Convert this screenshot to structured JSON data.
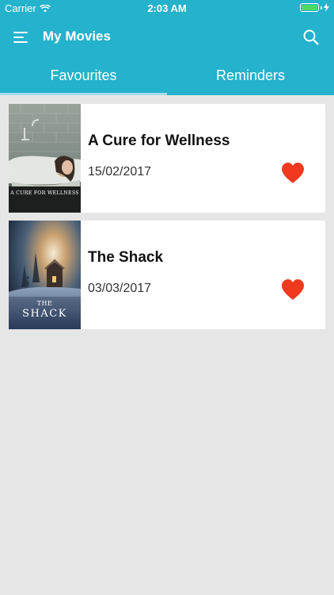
{
  "status_bar": {
    "carrier": "Carrier",
    "time": "2:03 AM"
  },
  "app_bar": {
    "title": "My Movies"
  },
  "tabs": [
    {
      "label": "Favourites",
      "active": true
    },
    {
      "label": "Reminders",
      "active": false
    }
  ],
  "movies": [
    {
      "title": "A Cure for Wellness",
      "date": "15/02/2017",
      "poster_caption": "A CURE FOR WELLNESS",
      "favourite": true
    },
    {
      "title": "The Shack",
      "date": "03/03/2017",
      "poster_caption_line1": "THE",
      "poster_caption_line2": "SHACK",
      "favourite": true
    }
  ],
  "colors": {
    "primary": "#24b2cc",
    "heart": "#f03a1f",
    "background": "#e6e6e6",
    "tab_indicator": "#a8dbe8"
  }
}
